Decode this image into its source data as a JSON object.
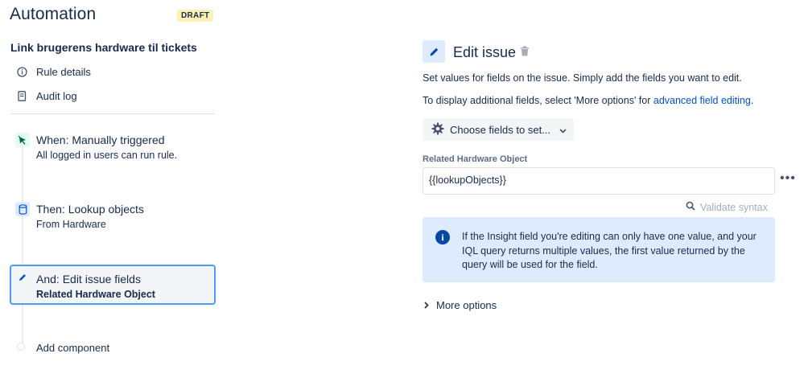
{
  "header": {
    "title": "Automation",
    "badge": "DRAFT"
  },
  "rule": {
    "name": "Link brugerens hardware til tickets",
    "menu": [
      {
        "label": "Rule details",
        "icon": "info-circle-icon"
      },
      {
        "label": "Audit log",
        "icon": "document-icon"
      }
    ],
    "steps": [
      {
        "title": "When: Manually triggered",
        "subtitle": "All logged in users can run rule.",
        "icon": "cursor-click-icon",
        "color": "#e3fcef"
      },
      {
        "title": "Then: Lookup objects",
        "subtitle": "From Hardware",
        "icon": "database-icon",
        "color": "#deebff"
      },
      {
        "title": "And: Edit issue fields",
        "subtitle": "Related Hardware Object",
        "icon": "pencil-icon",
        "color": "#deebff",
        "selected": true
      }
    ],
    "add_component": "Add component"
  },
  "panel": {
    "title": "Edit issue",
    "desc1": "Set values for fields on the issue. Simply add the fields you want to edit.",
    "desc2_prefix": "To display additional fields, select 'More options' for ",
    "desc2_link": "advanced field editing",
    "desc2_suffix": ".",
    "choose_button": "Choose fields to set...",
    "field_label": "Related Hardware Object",
    "field_value": "{{lookupObjects}}",
    "more_menu": "•••",
    "validate": "Validate syntax",
    "info": "If the Insight field you're editing can only have one value, and your IQL query returns multiple values, the first value returned by the query will be used for the field.",
    "more_options": "More options"
  },
  "colors": {
    "accent": "#0052cc",
    "selected_border": "#4c9aff",
    "info_bg": "#deebff",
    "badge_bg": "#fff0b3"
  }
}
